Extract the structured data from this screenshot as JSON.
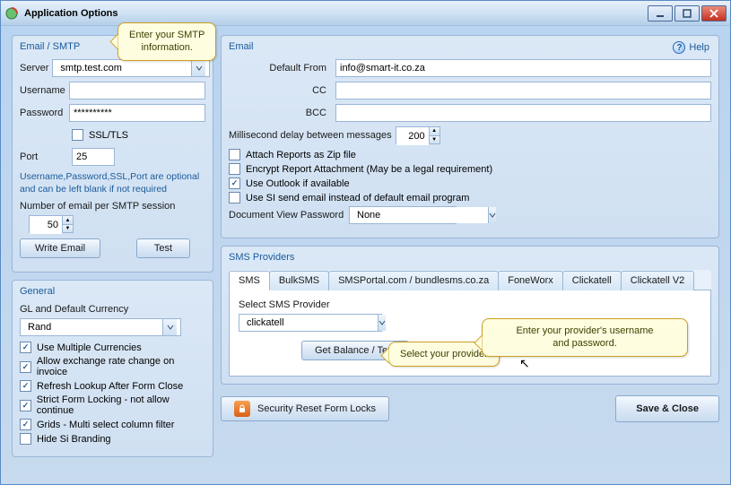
{
  "titlebar": {
    "title": "Application Options"
  },
  "help_label": "Help",
  "smtp": {
    "legend": "Email / SMTP",
    "server_label": "Server",
    "server_value": "smtp.test.com",
    "username_label": "Username",
    "username_value": "",
    "password_label": "Password",
    "password_value": "**********",
    "ssltls_label": "SSL/TLS",
    "ssltls_checked": false,
    "port_label": "Port",
    "port_value": "25",
    "note": "Username,Password,SSL,Port are optional and can be left blank if not required",
    "persession_label": "Number of email per SMTP session",
    "persession_value": "50",
    "write_email_btn": "Write Email",
    "test_btn": "Test"
  },
  "general": {
    "legend": "General",
    "gl_currency_label": "GL and Default Currency",
    "gl_currency_value": "Rand",
    "use_multi_curr": {
      "label": "Use Multiple Currencies",
      "checked": true
    },
    "allow_exch_rate": {
      "label": "Allow exchange rate change on invoice",
      "checked": true
    },
    "refresh_lookup": {
      "label": "Refresh Lookup After Form Close",
      "checked": true
    },
    "strict_lock": {
      "label": "Strict Form Locking - not allow continue",
      "checked": true
    },
    "grids_filter": {
      "label": "Grids - Multi select column filter",
      "checked": true
    },
    "hide_branding": {
      "label": "Hide Si Branding",
      "checked": false
    }
  },
  "email": {
    "legend": "Email",
    "default_from_label": "Default From",
    "default_from_value": "info@smart-it.co.za",
    "cc_label": "CC",
    "cc_value": "",
    "bcc_label": "BCC",
    "bcc_value": "",
    "ms_delay_label": "Millisecond delay between messages",
    "ms_delay_value": "200",
    "attach_zip": {
      "label": "Attach Reports as Zip file",
      "checked": false
    },
    "encrypt": {
      "label": "Encrypt Report Attachment (May be a legal requirement)",
      "checked": false
    },
    "use_outlook": {
      "label": "Use Outlook if available",
      "checked": true
    },
    "use_si_send": {
      "label": "Use SI send email instead of default email program",
      "checked": false
    },
    "docview_label": "Document View Password",
    "docview_value": "None"
  },
  "sms": {
    "legend": "SMS Providers",
    "tabs": [
      "SMS",
      "BulkSMS",
      "SMSPortal.com / bundlesms.co.za",
      "FoneWorx",
      "Clickatell",
      "Clickatell V2"
    ],
    "active_tab": 0,
    "select_provider_label": "Select SMS Provider",
    "provider_value": "clickatell",
    "get_balance_btn": "Get Balance / Test"
  },
  "security_reset_btn": "Security Reset Form Locks",
  "save_close_btn": "Save & Close",
  "callouts": {
    "smtp_info": "Enter your SMTP\ninformation.",
    "select_provider": "Select your provider",
    "userpass": "Enter your provider's username\nand password."
  }
}
